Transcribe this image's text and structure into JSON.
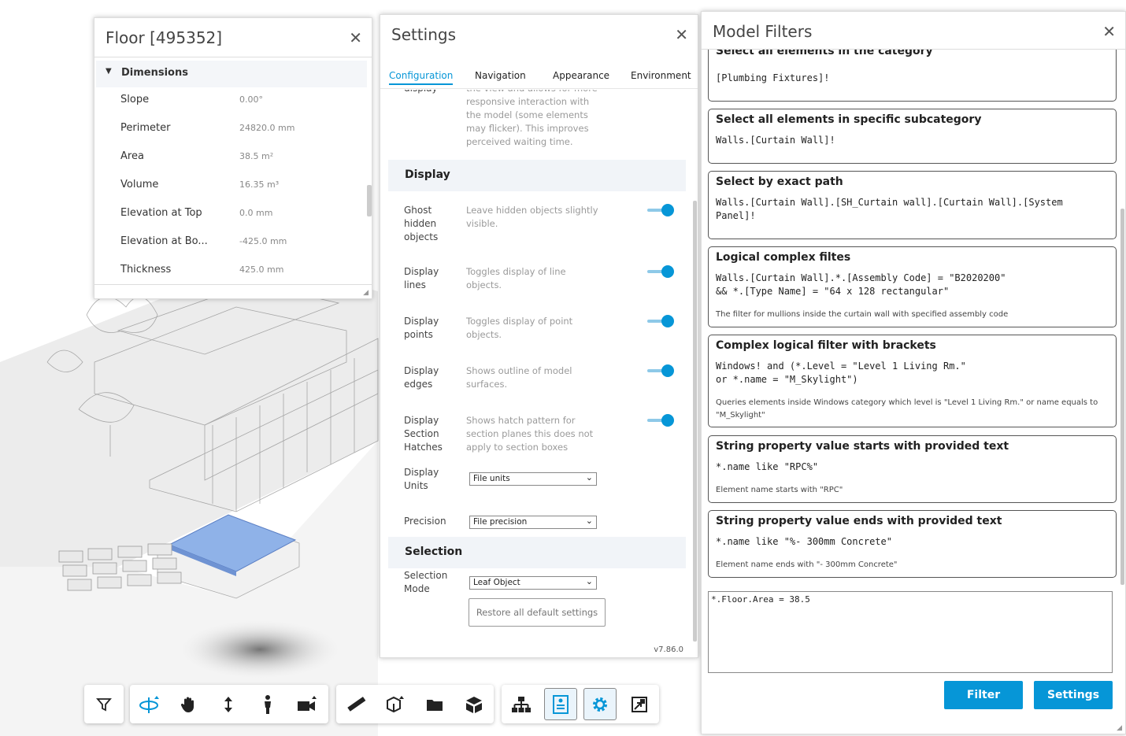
{
  "properties": {
    "title": "Floor [495352]",
    "section": "Dimensions",
    "rows": [
      {
        "key": "Slope",
        "value": "0.00°"
      },
      {
        "key": "Perimeter",
        "value": "24820.0 mm"
      },
      {
        "key": "Area",
        "value": "38.5 m²"
      },
      {
        "key": "Volume",
        "value": "16.35 m³"
      },
      {
        "key": "Elevation at Top",
        "value": "0.0 mm"
      },
      {
        "key": "Elevation at Bo...",
        "value": "-425.0 mm"
      },
      {
        "key": "Thickness",
        "value": "425.0 mm"
      }
    ]
  },
  "settings": {
    "title": "Settings",
    "tabs": [
      "Configuration",
      "Navigation",
      "Appearance",
      "Environment"
    ],
    "active_tab": "Configuration",
    "partial": {
      "key": "display",
      "desc": "the view and allows for more responsive interaction with the model (some elements may flicker). This improves perceived waiting time."
    },
    "display_group": "Display",
    "display_rows": [
      {
        "key": "Ghost hidden objects",
        "desc": "Leave hidden objects slightly visible.",
        "on": true
      },
      {
        "key": "Display lines",
        "desc": "Toggles display of line objects.",
        "on": true
      },
      {
        "key": "Display points",
        "desc": "Toggles display of point objects.",
        "on": true
      },
      {
        "key": "Display edges",
        "desc": "Shows outline of model surfaces.",
        "on": true
      },
      {
        "key": "Display Section Hatches",
        "desc": "Shows hatch pattern for section planes this does not apply to section boxes",
        "on": true
      }
    ],
    "units_label": "Display Units",
    "units_value": "File units",
    "precision_label": "Precision",
    "precision_value": "File precision",
    "selection_group": "Selection",
    "selection_label": "Selection Mode",
    "selection_value": "Leaf Object",
    "restore_label": "Restore all default settings",
    "version": "v7.86.0"
  },
  "filters": {
    "title": "Model Filters",
    "cards": [
      {
        "title": "Select all elements in the category",
        "code": "[Plumbing Fixtures]!",
        "note": ""
      },
      {
        "title": "Select all elements in specific subcategory",
        "code": "Walls.[Curtain Wall]!",
        "note": ""
      },
      {
        "title": "Select by exact path",
        "code": "Walls.[Curtain Wall].[SH_Curtain wall].[Curtain Wall].[System\nPanel]!",
        "note": ""
      },
      {
        "title": "Logical complex filtes",
        "code": "Walls.[Curtain Wall].*.[Assembly Code] = \"B2020200\"\n&& *.[Type Name] = \"64 x 128 rectangular\"",
        "note": "The filter for mullions inside the curtain wall with specified assembly code"
      },
      {
        "title": "Complex logical filter with brackets",
        "code": "Windows! and (*.Level = \"Level 1 Living Rm.\"\nor *.name = \"M_Skylight\")",
        "note": "Queries elements inside Windows category which level is \"Level 1 Living Rm.\" or name equals to \"M_Skylight\""
      },
      {
        "title": "String property value starts with provided text",
        "code": "*.name like \"RPC%\"",
        "note": "Element name starts with \"RPC\""
      },
      {
        "title": "String property value ends with provided text",
        "code": "*.name like \"%- 300mm Concrete\"",
        "note": "Element name ends with \"- 300mm Concrete\""
      }
    ],
    "query": "*.Floor.Area = 38.5",
    "filter_button": "Filter",
    "settings_button": "Settings"
  },
  "toolbar": {
    "groups": [
      [
        "filter-icon"
      ],
      [
        "orbit-icon",
        "pan-icon",
        "zoom-icon",
        "first-person-icon",
        "camera-icon"
      ],
      [
        "measure-icon",
        "section-icon",
        "explode-icon",
        "model-browser-icon"
      ],
      [
        "structure-icon",
        "properties-icon",
        "settings-icon",
        "fullscreen-icon"
      ]
    ],
    "accent": "#0696d7"
  },
  "colors": {
    "accent": "#0696d7",
    "selected_floor": "#8fb2e8"
  }
}
